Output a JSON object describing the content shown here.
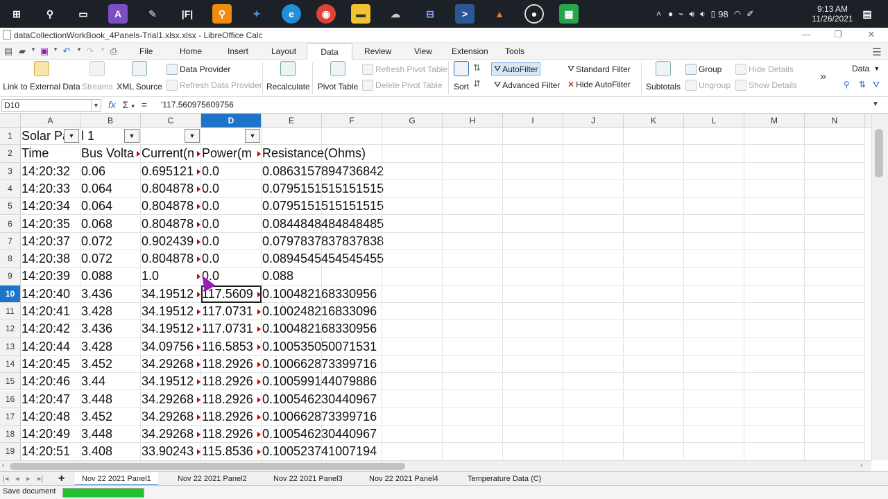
{
  "taskbar": {
    "time": "9:13 AM",
    "date": "11/26/2021",
    "battery": "98",
    "icons": [
      "windows-start",
      "search",
      "task-view",
      "affinity",
      "tool",
      "fi-app",
      "search-app",
      "paint-app",
      "edge",
      "chrome",
      "file-explorer",
      "network-app",
      "terminal",
      "matlab",
      "obs",
      "libreoffice-calc"
    ]
  },
  "window": {
    "title": "dataCollectionWorkBook_4Panels-Trial1.xlsx.xlsx - LibreOffice Calc"
  },
  "menu": {
    "tabs": [
      "File",
      "Home",
      "Insert",
      "Layout",
      "Data",
      "Review",
      "View",
      "Extension",
      "Tools"
    ],
    "active_tab": "Data"
  },
  "ribbon": {
    "link_external": "Link to External Data",
    "streams": "Streams",
    "xml_source": "XML Source",
    "data_provider": "Data Provider",
    "refresh_data_provider": "Refresh Data Provider",
    "recalculate": "Recalculate",
    "pivot_table": "Pivot Table",
    "refresh_pivot": "Refresh Pivot Table",
    "delete_pivot": "Delete Pivot Table",
    "sort": "Sort",
    "autofilter": "AutoFilter",
    "advanced_filter": "Advanced Filter",
    "standard_filter": "Standard Filter",
    "hide_autofilter": "Hide AutoFilter",
    "subtotals": "Subtotals",
    "group": "Group",
    "ungroup": "Ungroup",
    "hide_details": "Hide Details",
    "show_details": "Show Details",
    "more": "»",
    "data_dropdown": "Data"
  },
  "formula": {
    "name_box": "D10",
    "value": "'117.560975609756"
  },
  "columns": [
    "A",
    "B",
    "C",
    "D",
    "E",
    "F",
    "G",
    "H",
    "I",
    "J",
    "K",
    "L",
    "M",
    "N"
  ],
  "selected_column": "D",
  "selected_row": "10",
  "rows": [
    {
      "n": "1",
      "cells": [
        "Solar Pa",
        "l 1",
        "",
        "",
        "",
        ""
      ]
    },
    {
      "n": "2",
      "cells": [
        "Time",
        "Bus Volta",
        "Current(n",
        "Power(m",
        "Resistance(Ohms)",
        ""
      ]
    },
    {
      "n": "3",
      "cells": [
        "14:20:32",
        "0.06",
        "0.695121",
        "0.0",
        "0.0863157894736842",
        ""
      ]
    },
    {
      "n": "4",
      "cells": [
        "14:20:33",
        "0.064",
        "0.804878",
        "0.0",
        "0.0795151515151515",
        ""
      ]
    },
    {
      "n": "5",
      "cells": [
        "14:20:34",
        "0.064",
        "0.804878",
        "0.0",
        "0.0795151515151515",
        ""
      ]
    },
    {
      "n": "6",
      "cells": [
        "14:20:35",
        "0.068",
        "0.804878",
        "0.0",
        "0.0844848484848485",
        ""
      ]
    },
    {
      "n": "7",
      "cells": [
        "14:20:37",
        "0.072",
        "0.902439",
        "0.0",
        "0.0797837837837838",
        ""
      ]
    },
    {
      "n": "8",
      "cells": [
        "14:20:38",
        "0.072",
        "0.804878",
        "0.0",
        "0.0894545454545455",
        ""
      ]
    },
    {
      "n": "9",
      "cells": [
        "14:20:39",
        "0.088",
        "1.0",
        "0.0",
        "0.088",
        ""
      ]
    },
    {
      "n": "10",
      "cells": [
        "14:20:40",
        "3.436",
        "34.19512",
        "117.5609",
        "0.100482168330956",
        ""
      ]
    },
    {
      "n": "11",
      "cells": [
        "14:20:41",
        "3.428",
        "34.19512",
        "117.0731",
        "0.100248216833096",
        ""
      ]
    },
    {
      "n": "12",
      "cells": [
        "14:20:42",
        "3.436",
        "34.19512",
        "117.0731",
        "0.100482168330956",
        ""
      ]
    },
    {
      "n": "13",
      "cells": [
        "14:20:44",
        "3.428",
        "34.09756",
        "116.5853",
        "0.100535050071531",
        ""
      ]
    },
    {
      "n": "14",
      "cells": [
        "14:20:45",
        "3.452",
        "34.29268",
        "118.2926",
        "0.100662873399716",
        ""
      ]
    },
    {
      "n": "15",
      "cells": [
        "14:20:46",
        "3.44",
        "34.19512",
        "118.2926",
        "0.100599144079886",
        ""
      ]
    },
    {
      "n": "16",
      "cells": [
        "14:20:47",
        "3.448",
        "34.29268",
        "118.2926",
        "0.100546230440967",
        ""
      ]
    },
    {
      "n": "17",
      "cells": [
        "14:20:48",
        "3.452",
        "34.29268",
        "118.2926",
        "0.100662873399716",
        ""
      ]
    },
    {
      "n": "18",
      "cells": [
        "14:20:49",
        "3.448",
        "34.29268",
        "118.2926",
        "0.100546230440967",
        ""
      ]
    },
    {
      "n": "19",
      "cells": [
        "14:20:51",
        "3.408",
        "33.90243",
        "115.8536",
        "0.100523741007194",
        ""
      ]
    }
  ],
  "sheets": [
    "Nov 22 2021 Panel1",
    "Nov 22 2021 Panel2",
    "Nov 22 2021 Panel3",
    "Nov 22 2021 Panel4",
    "Temperature Data (C)"
  ],
  "active_sheet": "Nov 22 2021 Panel1",
  "status": {
    "text": "Save document",
    "progress": 1.0
  },
  "colors": {
    "selection": "#1e74c9",
    "progress": "#22c22e",
    "cursor": "#9b1bb5",
    "overflow_marker": "#cc0000"
  }
}
